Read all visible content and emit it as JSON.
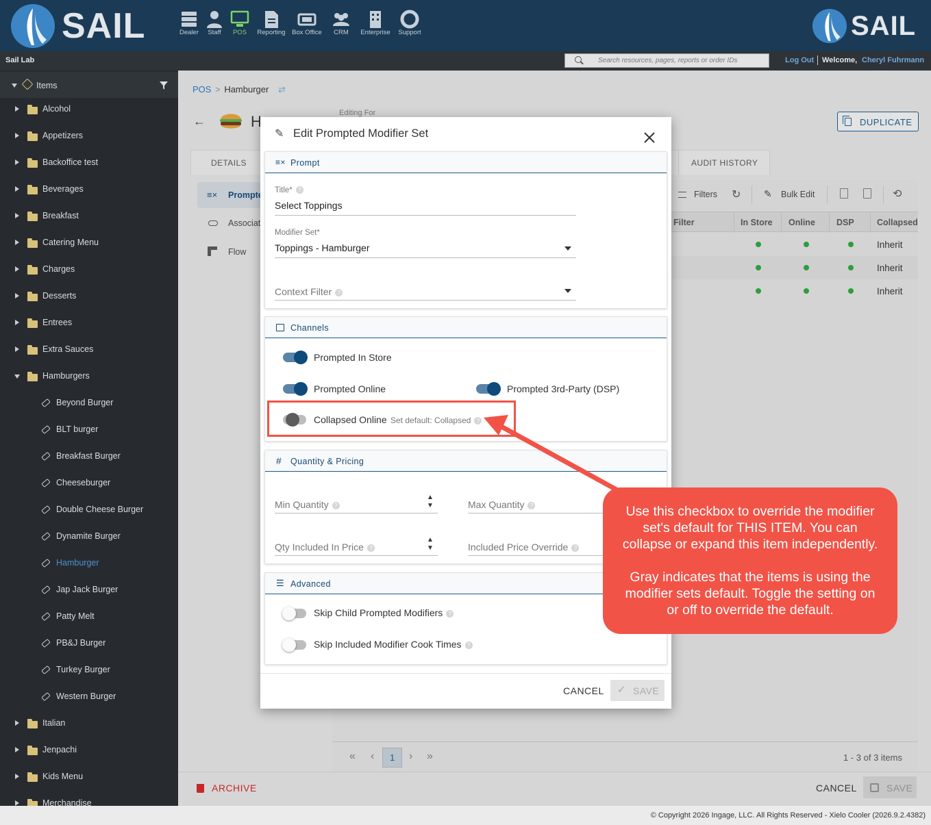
{
  "brand": {
    "name": "SAIL"
  },
  "topnav": [
    {
      "label": "Dealer",
      "icon": "dealer-icon"
    },
    {
      "label": "Staff",
      "icon": "staff-icon"
    },
    {
      "label": "POS",
      "icon": "pos-icon",
      "active": true
    },
    {
      "label": "Reporting",
      "icon": "reporting-icon"
    },
    {
      "label": "Box Office",
      "icon": "box-office-icon"
    },
    {
      "label": "CRM",
      "icon": "crm-icon"
    },
    {
      "label": "Enterprise",
      "icon": "enterprise-icon"
    },
    {
      "label": "Support",
      "icon": "support-icon"
    }
  ],
  "subbar": {
    "location": "Sail Lab",
    "search_placeholder": "Search resources, pages, reports or order IDs",
    "logout": "Log Out",
    "welcome": "Welcome,",
    "user": "Cheryl Fuhrmann"
  },
  "sidebar": {
    "root": "Items",
    "folders_before": [
      "Alcohol",
      "Appetizers",
      "Backoffice test",
      "Beverages",
      "Breakfast",
      "Catering Menu",
      "Charges",
      "Desserts",
      "Entrees",
      "Extra Sauces"
    ],
    "open_folder": "Hamburgers",
    "children": [
      "Beyond Burger",
      "BLT burger",
      "Breakfast Burger",
      "Cheeseburger",
      "Double Cheese Burger",
      "Dynamite Burger",
      "Hamburger",
      "Jap Jack Burger",
      "Patty Melt",
      "PB&J Burger",
      "Turkey Burger",
      "Western Burger"
    ],
    "selected_child": "Hamburger",
    "folders_after": [
      "Italian",
      "Jenpachi",
      "Kids Menu",
      "Merchandise"
    ]
  },
  "main": {
    "breadcrumb_root": "POS",
    "breadcrumb_sep": ">",
    "breadcrumb_current": "Hamburger",
    "item_title": "Hamburger",
    "editing_for": "Editing For",
    "duplicate": "DUPLICATE",
    "tabs": {
      "details": "DETAILS",
      "audit": "AUDIT HISTORY"
    },
    "subnav": [
      "Prompted Modifiers",
      "Associations",
      "Flow"
    ],
    "toolbar": {
      "filters": "Filters",
      "bulk_edit": "Bulk Edit"
    },
    "table": {
      "columns": [
        "Filter",
        "In Store",
        "Online",
        "DSP",
        "Collapsed"
      ],
      "rows": [
        {
          "collapsed": "Inherit"
        },
        {
          "collapsed": "Inherit"
        },
        {
          "collapsed": "Inherit"
        }
      ]
    },
    "pager": {
      "page": "1",
      "summary": "1 - 3 of 3 items"
    },
    "archive": "ARCHIVE",
    "cancel": "CANCEL",
    "save": "SAVE"
  },
  "modal": {
    "title": "Edit Prompted Modifier Set",
    "prompt": {
      "header": "Prompt",
      "title_label": "Title*",
      "title_value": "Select Toppings",
      "modifier_label": "Modifier Set*",
      "modifier_value": "Toppings - Hamburger",
      "context_label": "Context Filter"
    },
    "channels": {
      "header": "Channels",
      "in_store": "Prompted In Store",
      "online": "Prompted Online",
      "dsp": "Prompted 3rd-Party (DSP)",
      "collapsed": "Collapsed Online",
      "collapsed_default": "Set default: Collapsed"
    },
    "qty": {
      "header": "Quantity & Pricing",
      "min": "Min Quantity",
      "max": "Max Quantity",
      "included": "Qty Included In Price",
      "override": "Included Price Override"
    },
    "advanced": {
      "header": "Advanced",
      "skip_child": "Skip Child Prompted Modifiers",
      "skip_cook": "Skip Included Modifier Cook Times"
    },
    "cancel": "CANCEL",
    "save": "SAVE"
  },
  "callout": {
    "line1": "Use this checkbox to override the modifier set's default for THIS ITEM. You can collapse or expand this item independently.",
    "line2": "Gray indicates that the items is using the modifier sets default. Toggle the setting on or off to override the default."
  },
  "footer": {
    "text": "© Copyright 2026 Ingage, LLC. All Rights Reserved - Xielo Cooler (2026.9.2.4382)"
  },
  "colors": {
    "topbar": "#1b3a55",
    "accent": "#0e4a7a",
    "callout": "#f25347",
    "archive": "#c62828"
  }
}
